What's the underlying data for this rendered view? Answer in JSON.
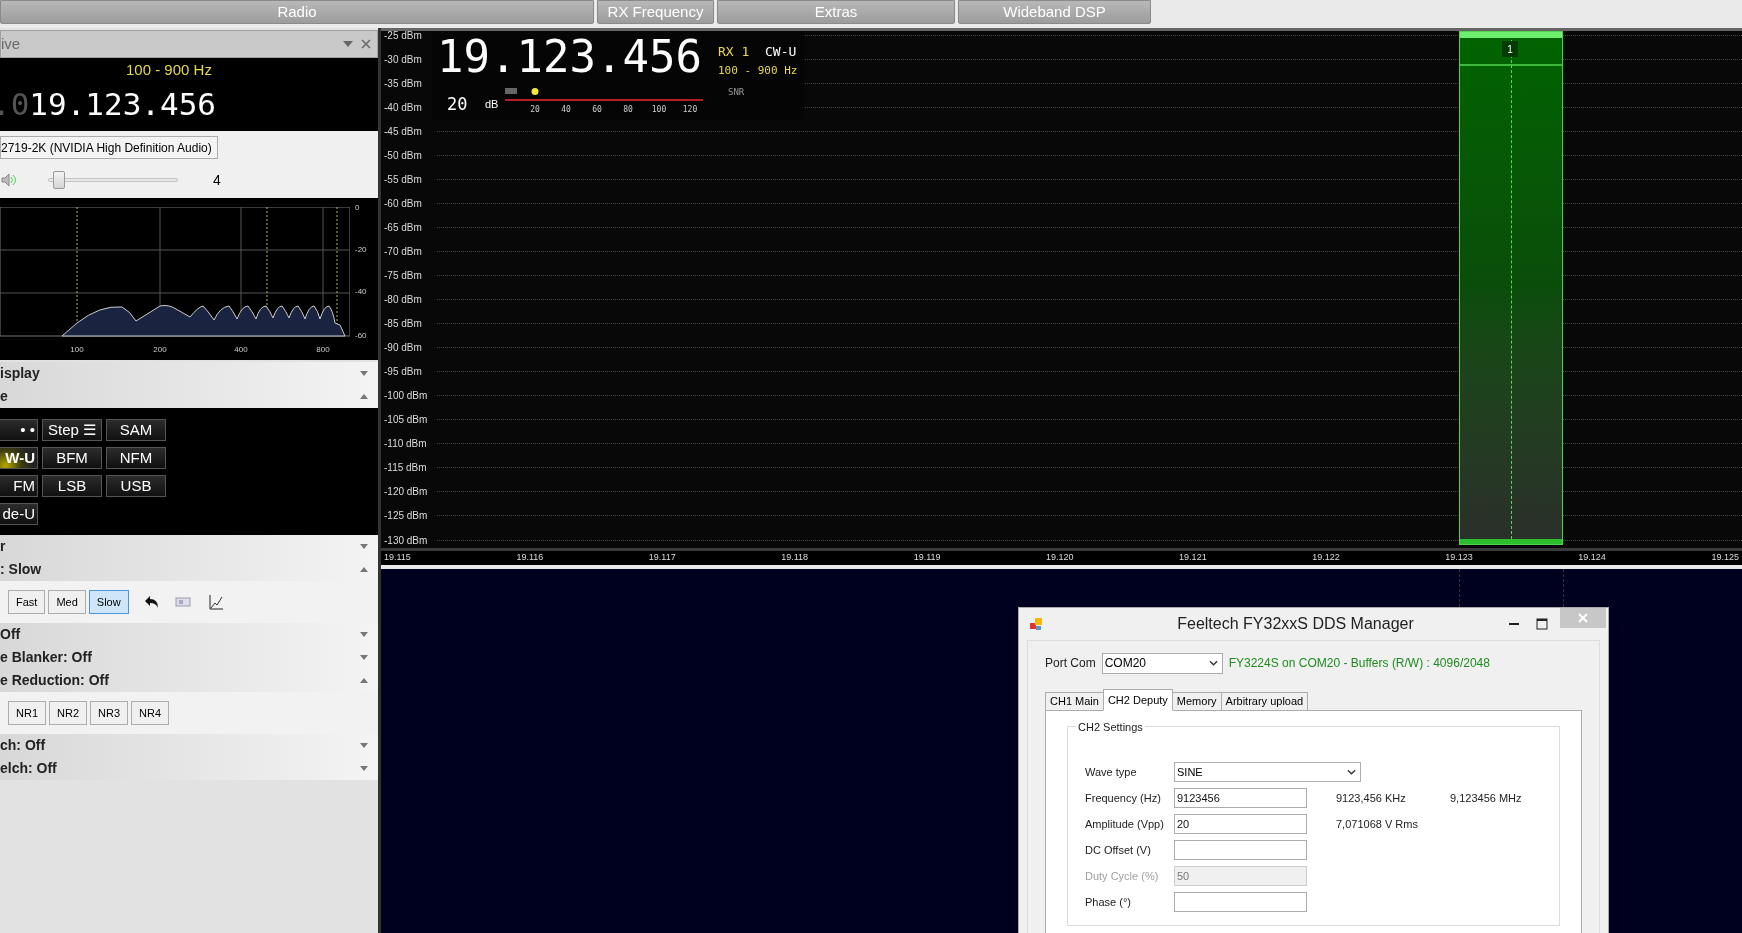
{
  "top_tabs": [
    {
      "label": "Radio"
    },
    {
      "label": "RX Frequency"
    },
    {
      "label": "Extras"
    },
    {
      "label": "Wideband DSP"
    }
  ],
  "left_panel": {
    "title": "ive",
    "filter_range": "100 - 900 Hz",
    "frequency_prefix": ".0",
    "frequency": "19.123.456",
    "audio_device": "2719-2K (NVIDIA High Definition Audio)",
    "volume": {
      "level": 0.04,
      "reading": "4"
    },
    "audio_spectrum": {
      "y_ticks": [
        "0",
        "-20",
        "-40",
        "-60"
      ],
      "x_ticks": [
        "100",
        "200",
        "400",
        "800"
      ]
    },
    "sections": [
      {
        "kind": "header",
        "label": "isplay",
        "expanded": false
      },
      {
        "kind": "header",
        "label": "e",
        "expanded": true
      },
      {
        "kind": "modes",
        "buttons": [
          {
            "label": "• •",
            "selected": false
          },
          {
            "label": "Step ☰",
            "selected": false
          },
          {
            "label": "SAM",
            "selected": false
          },
          {
            "label": "W-U",
            "selected": true
          },
          {
            "label": "BFM",
            "selected": false
          },
          {
            "label": "NFM",
            "selected": false
          },
          {
            "label": "FM",
            "selected": false
          },
          {
            "label": "LSB",
            "selected": false
          },
          {
            "label": "USB",
            "selected": false
          },
          {
            "label": "de-U",
            "selected": false
          }
        ]
      },
      {
        "kind": "header",
        "label": "r",
        "expanded": false
      },
      {
        "kind": "header",
        "label": ": Slow",
        "expanded": true
      },
      {
        "kind": "button_row_tools",
        "buttons": [
          {
            "label": "Fast",
            "selected": false
          },
          {
            "label": "Med",
            "selected": false
          },
          {
            "label": "Slow",
            "selected": true
          }
        ]
      },
      {
        "kind": "header",
        "label": "Off",
        "expanded": false
      },
      {
        "kind": "header",
        "label": "e Blanker: Off",
        "expanded": false
      },
      {
        "kind": "header",
        "label": "e Reduction: Off",
        "expanded": true
      },
      {
        "kind": "button_row",
        "buttons": [
          {
            "label": "NR1",
            "selected": false
          },
          {
            "label": "NR2",
            "selected": false
          },
          {
            "label": "NR3",
            "selected": false
          },
          {
            "label": "NR4",
            "selected": false
          }
        ]
      },
      {
        "kind": "header",
        "label": "ch: Off",
        "expanded": false
      },
      {
        "kind": "header",
        "label": "elch: Off",
        "expanded": false
      }
    ]
  },
  "spectrum": {
    "dbm_labels": [
      "-25 dBm",
      "-30 dBm",
      "-35 dBm",
      "-40 dBm",
      "-45 dBm",
      "-50 dBm",
      "-55 dBm",
      "-60 dBm",
      "-65 dBm",
      "-70 dBm",
      "-75 dBm",
      "-80 dBm",
      "-85 dBm",
      "-90 dBm",
      "-95 dBm",
      "-100 dBm",
      "-105 dBm",
      "-110 dBm",
      "-115 dBm",
      "-120 dBm",
      "-125 dBm",
      "-130 dBm"
    ],
    "freq_labels": [
      "19.115",
      "19.116",
      "19.117",
      "19.118",
      "19.119",
      "19.120",
      "19.121",
      "19.122",
      "19.123",
      "19.124",
      "19.125"
    ],
    "overlay": {
      "frequency": "19.123.456",
      "receiver": "RX 1",
      "mode": "CW-U",
      "filter": "100 - 900 Hz",
      "snr": "20",
      "snr_unit": "dB",
      "snr_label": "SNR",
      "snr_meter": {
        "level": 0.15
      },
      "scale": [
        "20",
        "40",
        "60",
        "80",
        "100",
        "120"
      ]
    },
    "filter_marker": "1"
  },
  "dialog": {
    "title": "Feeltech FY32xxS DDS Manager",
    "port_label": "Port Com",
    "port": "COM20",
    "status": "FY3224S on COM20 - Buffers (R/W) : 4096/2048",
    "tabs": [
      {
        "label": "CH1 Main",
        "selected": false
      },
      {
        "label": "CH2 Deputy",
        "selected": true
      },
      {
        "label": "Memory",
        "selected": false
      },
      {
        "label": "Arbitrary upload",
        "selected": false
      }
    ],
    "group": "CH2 Settings",
    "fields": [
      {
        "label": "Wave type",
        "kind": "select",
        "value": "SINE",
        "disabled": false
      },
      {
        "label": "Frequency (Hz)",
        "kind": "input",
        "value": "9123456",
        "notes": [
          "9123,456 KHz",
          "9,123456 MHz"
        ],
        "disabled": false
      },
      {
        "label": "Amplitude (Vpp)",
        "kind": "input",
        "value": "20",
        "notes": [
          "7,071068 V Rms"
        ],
        "disabled": false
      },
      {
        "label": "DC Offset (V)",
        "kind": "input",
        "disabled": false
      },
      {
        "label": "Duty Cycle (%)",
        "kind": "input",
        "value": "50",
        "disabled": true
      },
      {
        "label": "Phase (°)",
        "kind": "input",
        "disabled": false
      }
    ]
  }
}
